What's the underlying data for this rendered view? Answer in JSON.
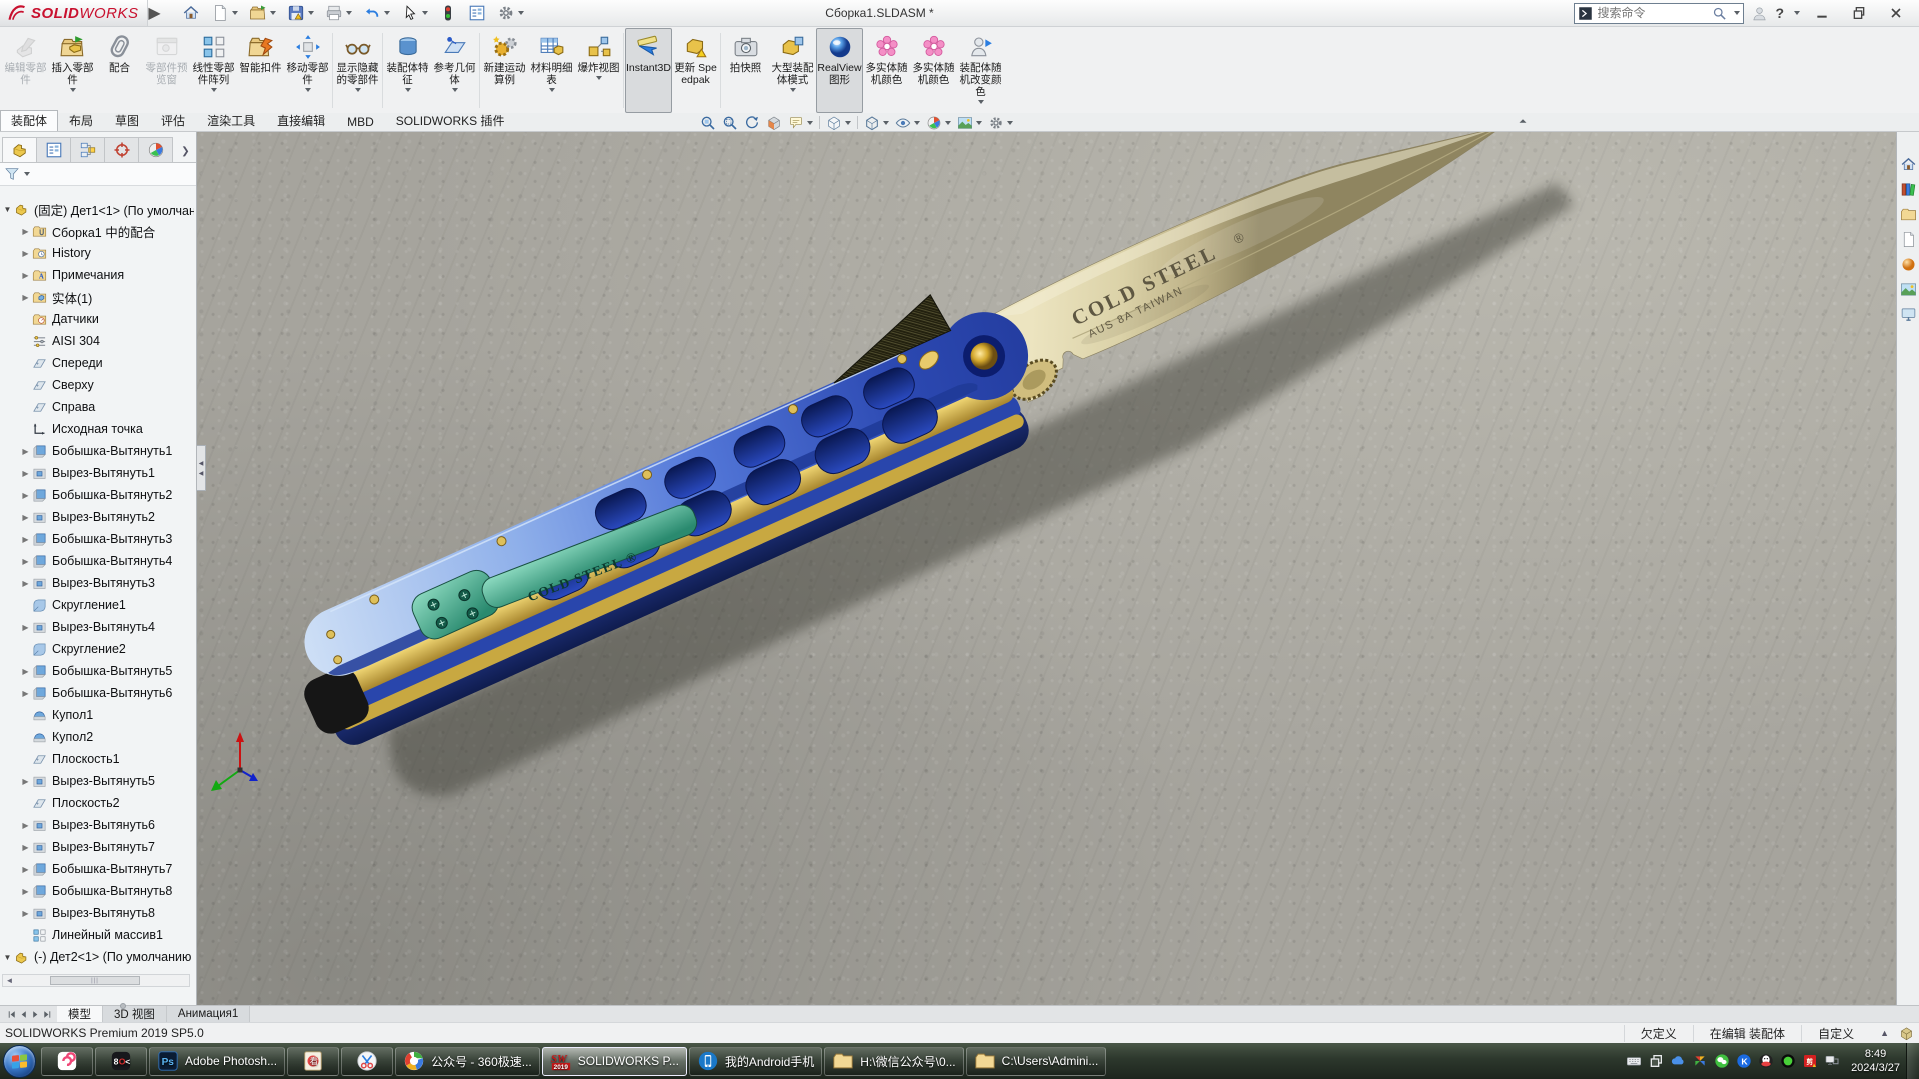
{
  "titlebar": {
    "brand_bold": "SOLID",
    "brand_light": "WORKS",
    "title": "Сборка1.SLDASM *",
    "search_placeholder": "搜索命令",
    "help_label": "?",
    "qat": [
      {
        "icon": "home"
      },
      {
        "icon": "newdoc",
        "caret": true
      },
      {
        "icon": "open",
        "caret": true
      },
      {
        "icon": "save",
        "caret": true
      },
      {
        "icon": "print",
        "caret": true
      },
      {
        "icon": "undo",
        "caret": true
      },
      {
        "icon": "cursor",
        "caret": true
      },
      {
        "icon": "traffic"
      },
      {
        "icon": "props"
      },
      {
        "icon": "gear",
        "caret": true
      }
    ]
  },
  "ribbon": {
    "buttons": [
      {
        "label": "编辑零部件",
        "icon": "editpart",
        "disabled": true
      },
      {
        "label": "插入零部件",
        "icon": "insertpart",
        "caret": true
      },
      {
        "label": "配合",
        "icon": "mate"
      },
      {
        "label": "零部件预览窗",
        "icon": "preview",
        "disabled": true
      },
      {
        "label": "线性零部件阵列",
        "icon": "linpat",
        "caret": true
      },
      {
        "label": "智能扣件",
        "icon": "fastener"
      },
      {
        "label": "移动零部件",
        "icon": "move",
        "caret": true,
        "sep": true
      },
      {
        "label": "显示隐藏的零部件",
        "icon": "glasses",
        "caret": true,
        "sep": true
      },
      {
        "label": "装配体特征",
        "icon": "asmfeat",
        "caret": true
      },
      {
        "label": "参考几何体",
        "icon": "refgeo",
        "caret": true,
        "sep": true
      },
      {
        "label": "新建运动算例",
        "icon": "motion"
      },
      {
        "label": "材料明细表",
        "icon": "bom",
        "caret": true
      },
      {
        "label": "爆炸视图",
        "icon": "explode",
        "caret": true,
        "sep": true
      },
      {
        "label": "Instant3D",
        "icon": "instant3d",
        "pressed": true
      },
      {
        "label": "更新 Speedpak",
        "icon": "speedpak",
        "sep": true
      },
      {
        "label": "拍快照",
        "icon": "snapshot"
      },
      {
        "label": "大型装配体模式",
        "icon": "largeasm",
        "caret": true
      },
      {
        "label": "RealView图形",
        "icon": "realview",
        "pressed": true
      },
      {
        "label": "多实体随机颜色",
        "icon": "flower"
      },
      {
        "label": "多实体随机颜色",
        "icon": "flower"
      },
      {
        "label": "装配体随机改变颜色",
        "icon": "personcolor",
        "caret": true
      }
    ],
    "tabs": [
      {
        "label": "装配体",
        "active": true
      },
      {
        "label": "布局"
      },
      {
        "label": "草图"
      },
      {
        "label": "评估"
      },
      {
        "label": "渲染工具"
      },
      {
        "label": "直接编辑"
      },
      {
        "label": "MBD"
      },
      {
        "label": "SOLIDWORKS 插件"
      }
    ]
  },
  "headsup": [
    {
      "icon": "hu-fit",
      "name": "zoom-fit-icon"
    },
    {
      "icon": "hu-area",
      "name": "zoom-area-icon"
    },
    {
      "icon": "hu-prev",
      "name": "previous-view-icon"
    },
    {
      "icon": "hu-section",
      "name": "section-view-icon"
    },
    {
      "icon": "hu-annot",
      "name": "annotation-view-icon",
      "caret": true
    },
    {
      "sep": true
    },
    {
      "icon": "hu-orient",
      "name": "view-orientation-icon",
      "caret": true
    },
    {
      "sep": true
    },
    {
      "icon": "hu-style",
      "name": "display-style-icon",
      "caret": true
    },
    {
      "icon": "hu-hide",
      "name": "hide-show-items-icon",
      "caret": true
    },
    {
      "icon": "ballrgb",
      "name": "edit-appearance-icon",
      "caret": true
    },
    {
      "icon": "rs-scene",
      "name": "apply-scene-icon",
      "caret": true
    },
    {
      "icon": "hu-settings",
      "name": "view-settings-icon",
      "caret": true
    }
  ],
  "panel": {
    "tabs_icons": [
      "part",
      "props",
      "config",
      "dimx",
      "ballrgb"
    ],
    "tree": [
      {
        "label": "(固定) Дет1<1> (По умолчани",
        "icon": "part",
        "exp": "open",
        "lvl": 0
      },
      {
        "label": "Сборка1 中的配合",
        "icon": "mates",
        "exp": "closed",
        "lvl": 1
      },
      {
        "label": "History",
        "icon": "history",
        "exp": "closed",
        "lvl": 1
      },
      {
        "label": "Примечания",
        "icon": "notes",
        "exp": "closed",
        "lvl": 1
      },
      {
        "label": "实体(1)",
        "icon": "bodies",
        "exp": "closed",
        "lvl": 1
      },
      {
        "label": "Датчики",
        "icon": "sensors",
        "exp": "none",
        "lvl": 1
      },
      {
        "label": "AISI 304",
        "icon": "material",
        "exp": "none",
        "lvl": 1
      },
      {
        "label": "Спереди",
        "icon": "plane",
        "exp": "none",
        "lvl": 1
      },
      {
        "label": "Сверху",
        "icon": "plane",
        "exp": "none",
        "lvl": 1
      },
      {
        "label": "Справа",
        "icon": "plane",
        "exp": "none",
        "lvl": 1
      },
      {
        "label": "Исходная точка",
        "icon": "origin",
        "exp": "none",
        "lvl": 1
      },
      {
        "label": "Бобышка-Вытянуть1",
        "icon": "boss",
        "exp": "closed",
        "lvl": 1
      },
      {
        "label": "Вырез-Вытянуть1",
        "icon": "cut",
        "exp": "closed",
        "lvl": 1
      },
      {
        "label": "Бобышка-Вытянуть2",
        "icon": "boss",
        "exp": "closed",
        "lvl": 1
      },
      {
        "label": "Вырез-Вытянуть2",
        "icon": "cut",
        "exp": "closed",
        "lvl": 1
      },
      {
        "label": "Бобышка-Вытянуть3",
        "icon": "boss",
        "exp": "closed",
        "lvl": 1
      },
      {
        "label": "Бобышка-Вытянуть4",
        "icon": "boss",
        "exp": "closed",
        "lvl": 1
      },
      {
        "label": "Вырез-Вытянуть3",
        "icon": "cut",
        "exp": "closed",
        "lvl": 1
      },
      {
        "label": "Скругление1",
        "icon": "fillet",
        "exp": "none",
        "lvl": 1
      },
      {
        "label": "Вырез-Вытянуть4",
        "icon": "cut",
        "exp": "closed",
        "lvl": 1
      },
      {
        "label": "Скругление2",
        "icon": "fillet",
        "exp": "none",
        "lvl": 1
      },
      {
        "label": "Бобышка-Вытянуть5",
        "icon": "boss",
        "exp": "closed",
        "lvl": 1
      },
      {
        "label": "Бобышка-Вытянуть6",
        "icon": "boss",
        "exp": "closed",
        "lvl": 1
      },
      {
        "label": "Купол1",
        "icon": "dome",
        "exp": "none",
        "lvl": 1
      },
      {
        "label": "Купол2",
        "icon": "dome",
        "exp": "none",
        "lvl": 1
      },
      {
        "label": "Плоскость1",
        "icon": "plane",
        "exp": "none",
        "lvl": 1
      },
      {
        "label": "Вырез-Вытянуть5",
        "icon": "cut",
        "exp": "closed",
        "lvl": 1
      },
      {
        "label": "Плоскость2",
        "icon": "plane",
        "exp": "none",
        "lvl": 1
      },
      {
        "label": "Вырез-Вытянуть6",
        "icon": "cut",
        "exp": "closed",
        "lvl": 1
      },
      {
        "label": "Вырез-Вытянуть7",
        "icon": "cut",
        "exp": "closed",
        "lvl": 1
      },
      {
        "label": "Бобышка-Вытянуть7",
        "icon": "boss",
        "exp": "closed",
        "lvl": 1
      },
      {
        "label": "Бобышка-Вытянуть8",
        "icon": "boss",
        "exp": "closed",
        "lvl": 1
      },
      {
        "label": "Вырез-Вытянуть8",
        "icon": "cut",
        "exp": "closed",
        "lvl": 1
      },
      {
        "label": "Линейный массив1",
        "icon": "linpat",
        "exp": "none",
        "lvl": 1
      },
      {
        "label": "(-) Дет2<1> (По умолчанию",
        "icon": "part",
        "exp": "open",
        "lvl": 0
      }
    ]
  },
  "right_strip": [
    "home",
    "rs-lib",
    "folder",
    "newdoc",
    "rs-ball",
    "rs-scene",
    "rs-monitor"
  ],
  "canvas": {
    "blade_line1": "COLD STEEL",
    "blade_reg": "®",
    "blade_line2": "AUS 8A TAIWAN",
    "clip_text": "COLD STEEL ®"
  },
  "model_tabs": {
    "tabs": [
      {
        "label": "模型",
        "active": true
      },
      {
        "label": "3D 视图",
        "active": false
      },
      {
        "label": "Анимация1",
        "active": false
      }
    ]
  },
  "statusbar": {
    "left": "SOLIDWORKS Premium 2019 SP5.0",
    "items": [
      "欠定义",
      "在编辑 装配体",
      "自定义"
    ]
  },
  "taskbar": {
    "items": [
      {
        "icon": "tb-360",
        "label": "",
        "name": "taskbar-360-assistant"
      },
      {
        "icon": "tb-bok",
        "label": "",
        "name": "taskbar-bok-app"
      },
      {
        "icon": "tb-ps",
        "label": "Adobe Photosh...",
        "name": "taskbar-photoshop"
      },
      {
        "icon": "tb-pic",
        "label": "",
        "name": "taskbar-image-viewer"
      },
      {
        "icon": "tb-scissors",
        "label": "",
        "name": "taskbar-snip-tool"
      },
      {
        "icon": "tb-360b",
        "label": "公众号 - 360极速...",
        "name": "taskbar-360-browser"
      },
      {
        "icon": "tb-sw",
        "label": "SOLIDWORKS P...",
        "active": true,
        "name": "taskbar-solidworks"
      },
      {
        "icon": "tb-phone",
        "label": "我的Android手机",
        "name": "taskbar-android-phone"
      },
      {
        "icon": "folder",
        "label": "H:\\微信公众号\\0...",
        "name": "taskbar-folder-h"
      },
      {
        "icon": "folder",
        "label": "C:\\Users\\Admini...",
        "name": "taskbar-folder-c"
      }
    ],
    "tray_icons": [
      "tr-kb",
      "tr-win",
      "tr-cloud",
      "tr-pin",
      "tr-wechat",
      "tr-k",
      "tr-qq",
      "tr-green",
      "tr-stamp",
      "tr-net"
    ],
    "clock_time": "8:49",
    "clock_date": "2024/3/27"
  }
}
